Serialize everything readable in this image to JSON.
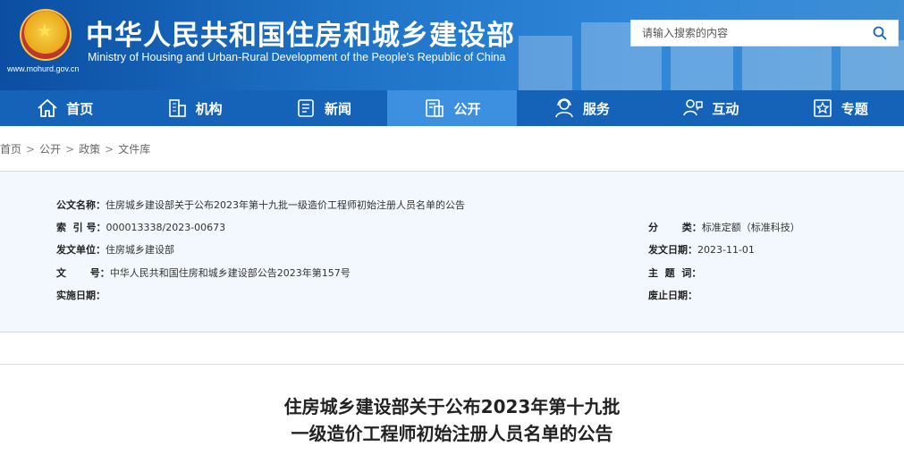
{
  "header": {
    "title": "中华人民共和国住房和城乡建设部",
    "subtitle": "Ministry of Housing and Urban-Rural Development of the People’s Republic of China",
    "url": "www.mohurd.gov.cn",
    "emblem_icon": "national-emblem-icon",
    "search": {
      "placeholder": "请输入搜索的内容",
      "icon": "search-icon"
    }
  },
  "nav": {
    "items": [
      {
        "label": "首页",
        "icon": "home-icon"
      },
      {
        "label": "机构",
        "icon": "building-icon"
      },
      {
        "label": "新闻",
        "icon": "newspaper-icon"
      },
      {
        "label": "公开",
        "icon": "document-icon",
        "active": true
      },
      {
        "label": "服务",
        "icon": "service-icon"
      },
      {
        "label": "互动",
        "icon": "interaction-icon"
      },
      {
        "label": "专题",
        "icon": "topic-icon"
      }
    ]
  },
  "breadcrumb": [
    "首页",
    "公开",
    "政策",
    "文件库"
  ],
  "meta": {
    "doc_name_label": "公文名称：",
    "doc_name": "住房城乡建设部关于公布2023年第十九批一级造价工程师初始注册人员名单的公告",
    "index_label": "索  引 号：",
    "index": "000013338/2023-00673",
    "category_label": "分       类：",
    "category": "标准定额（标准科技）",
    "issuer_label": "发文单位：",
    "issuer": "住房城乡建设部",
    "date_label": "发文日期：",
    "date": "2023-11-01",
    "docno_label": "文       号：",
    "docno": "中华人民共和国住房和城乡建设部公告2023年第157号",
    "keywords_label": "主  题  词：",
    "keywords": "",
    "effective_label": "实施日期：",
    "effective": "",
    "expire_label": "废止日期：",
    "expire": ""
  },
  "article": {
    "title_line1": "住房城乡建设部关于公布2023年第十九批",
    "title_line2": "一级造价工程师初始注册人员名单的公告"
  },
  "colors": {
    "nav_bg": "#1463b9",
    "nav_active": "#3d8fe0",
    "meta_bg": "#f2f8fd"
  }
}
